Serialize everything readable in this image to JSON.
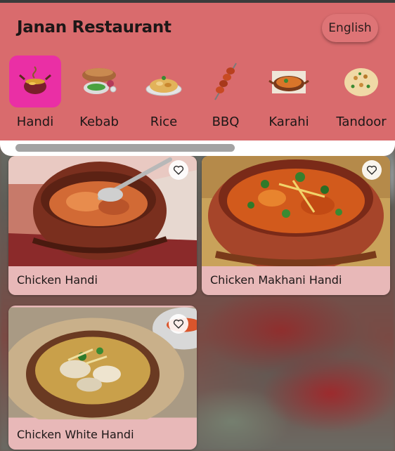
{
  "app": {
    "title": "Janan Restaurant",
    "language_label": "English"
  },
  "categories": [
    {
      "label": "Handi",
      "icon": "handi-icon",
      "selected": true
    },
    {
      "label": "Kebab",
      "icon": "kebab-icon",
      "selected": false
    },
    {
      "label": "Rice",
      "icon": "rice-icon",
      "selected": false
    },
    {
      "label": "BBQ",
      "icon": "bbq-icon",
      "selected": false
    },
    {
      "label": "Karahi",
      "icon": "karahi-icon",
      "selected": false
    },
    {
      "label": "Tandoor",
      "icon": "tandoor-icon",
      "selected": false
    }
  ],
  "dishes": [
    {
      "name": "Chicken Handi",
      "favorite": false
    },
    {
      "name": "Chicken Makhani Handi",
      "favorite": false
    },
    {
      "name": "Chicken White Handi",
      "favorite": false
    }
  ],
  "colors": {
    "header": "#d96b6d",
    "selected_category": "#ea2fa5",
    "card": "#e8b8b8"
  }
}
